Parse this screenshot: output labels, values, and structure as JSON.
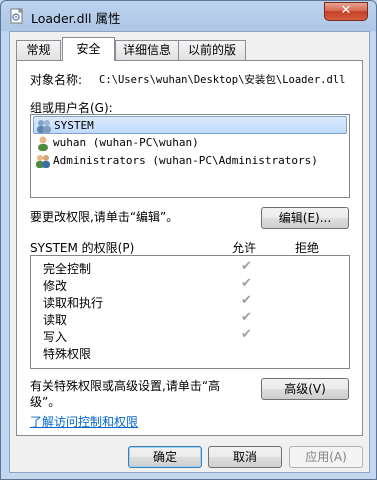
{
  "window": {
    "title": "Loader.dll 属性",
    "close_glyph": "✕"
  },
  "tabs": [
    {
      "label": "常规"
    },
    {
      "label": "安全"
    },
    {
      "label": "详细信息"
    },
    {
      "label": "以前的版本"
    }
  ],
  "object": {
    "label": "对象名称:",
    "value": "C:\\Users\\wuhan\\Desktop\\安装包\\Loader.dll"
  },
  "groups": {
    "label": "组或用户名(G):",
    "items": [
      {
        "label": "SYSTEM"
      },
      {
        "label": "wuhan (wuhan-PC\\wuhan)"
      },
      {
        "label": "Administrators (wuhan-PC\\Administrators)"
      }
    ]
  },
  "change_hint": "要更改权限,请单击“编辑”。",
  "edit_button": "编辑(E)...",
  "permissions": {
    "header": "SYSTEM 的权限(P)",
    "allow_header": "允许",
    "deny_header": "拒绝",
    "check_glyph": "✔",
    "rows": [
      {
        "name": "完全控制",
        "allow": true
      },
      {
        "name": "修改",
        "allow": true
      },
      {
        "name": "读取和执行",
        "allow": true
      },
      {
        "name": "读取",
        "allow": true
      },
      {
        "name": "写入",
        "allow": true
      },
      {
        "name": "特殊权限",
        "allow": false
      }
    ]
  },
  "advanced": {
    "hint_line1": "有关特殊权限或高级设置,请单击“高",
    "hint_line2": "级”。",
    "button": "高级(V)"
  },
  "learn_link": "了解访问控制和权限",
  "footer": {
    "ok": "确定",
    "cancel": "取消",
    "apply": "应用(A)"
  }
}
